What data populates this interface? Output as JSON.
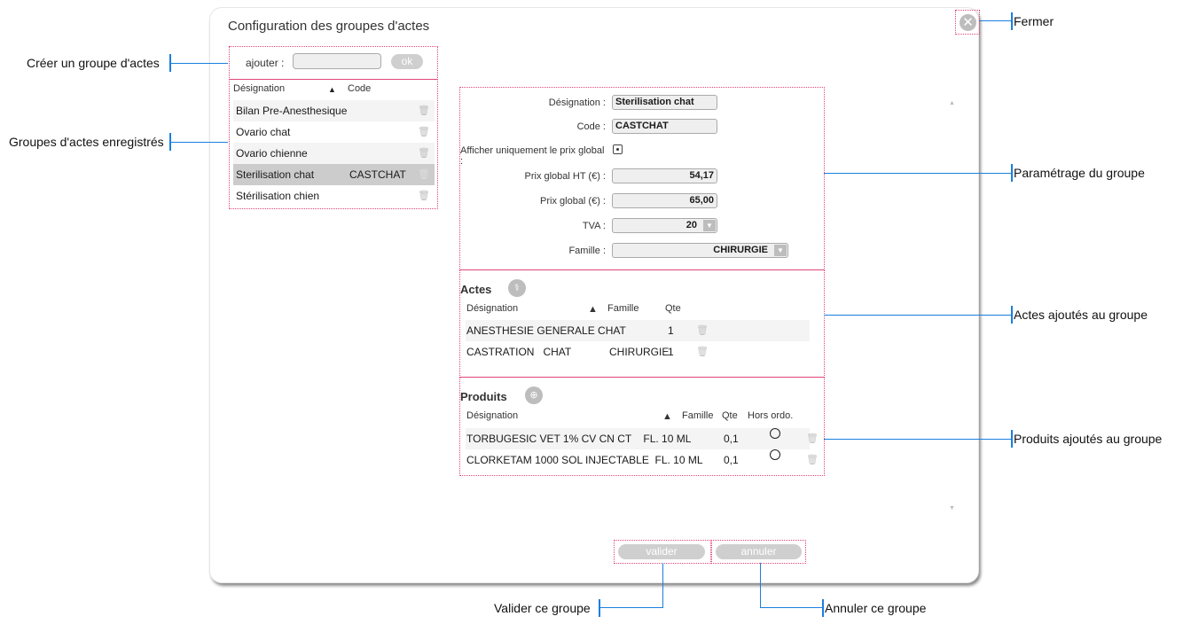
{
  "dialog": {
    "title": "Configuration des groupes d'actes",
    "close_icon": "close-circle-icon"
  },
  "add_group": {
    "label": "ajouter :",
    "input_value": "",
    "ok_label": "ok"
  },
  "groups_list": {
    "headers": {
      "designation": "Désignation",
      "code": "Code",
      "sort_indicator": "▲"
    },
    "rows": [
      {
        "designation": "Bilan Pre-Anesthesique",
        "code": "",
        "selected": false
      },
      {
        "designation": "Ovario chat",
        "code": "",
        "selected": false
      },
      {
        "designation": "Ovario chienne",
        "code": "",
        "selected": false
      },
      {
        "designation": "Sterilisation chat",
        "code": "CASTCHAT",
        "selected": true
      },
      {
        "designation": "Stérilisation chien",
        "code": "",
        "selected": false
      }
    ]
  },
  "params": {
    "designation_label": "Désignation :",
    "designation_value": "Sterilisation chat",
    "code_label": "Code :",
    "code_value": "CASTCHAT",
    "show_global_label": "Afficher uniquement le prix global :",
    "show_global_checked": true,
    "prix_ht_label": "Prix global HT (€) :",
    "prix_ht_value": "54,17",
    "prix_label": "Prix global (€) :",
    "prix_value": "65,00",
    "tva_label": "TVA :",
    "tva_value": "20",
    "famille_label": "Famille :",
    "famille_value": "CHIRURGIE"
  },
  "actes": {
    "title": "Actes",
    "add_icon": "add-acte-icon",
    "headers": {
      "designation": "Désignation",
      "sort_indicator": "▲",
      "famille": "Famille",
      "qte": "Qte"
    },
    "rows": [
      {
        "designation": "ANESTHESIE GENERALE CHAT",
        "famille": "",
        "qte": "1"
      },
      {
        "designation": "CASTRATION   CHAT",
        "famille": "CHIRURGIE",
        "qte": "1"
      }
    ]
  },
  "produits": {
    "title": "Produits",
    "add_icon": "add-product-icon",
    "headers": {
      "designation": "Désignation",
      "sort_indicator": "▲",
      "famille": "Famille",
      "qte": "Qte",
      "hors_ordo": "Hors ordo."
    },
    "rows": [
      {
        "designation": "TORBUGESIC VET 1% CV CN CT    FL. 10 ML",
        "famille": "",
        "qte": "0,1",
        "hors_ordo": false
      },
      {
        "designation": "CLORKETAM 1000 SOL INJECTABLE  FL. 10 ML",
        "famille": "",
        "qte": "0,1",
        "hors_ordo": false
      }
    ]
  },
  "footer": {
    "valider_label": "valider",
    "annuler_label": "annuler"
  },
  "annotations": {
    "creer": "Créer un groupe  d'actes",
    "groupes": "Groupes d'actes enregistrés",
    "fermer": "Fermer",
    "parametrage": "Paramétrage du groupe",
    "actes": "Actes ajoutés au groupe",
    "produits": "Produits ajoutés au groupe",
    "valider": "Valider ce groupe",
    "annuler": "Annuler ce groupe"
  },
  "colors": {
    "highlight_border": "#e0457b",
    "annotation_line": "#1a7fe0",
    "selected_row": "#cccccc",
    "button_gray": "#cfcfcf"
  }
}
